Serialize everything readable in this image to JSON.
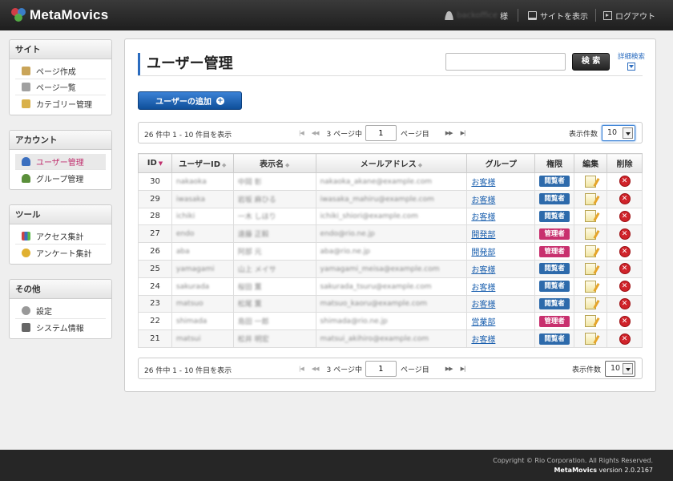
{
  "header": {
    "app_name": "MetaMovics",
    "user_name": "backoffice",
    "user_suffix": "様",
    "view_site": "サイトを表示",
    "logout": "ログアウト"
  },
  "sidebar": [
    {
      "title": "サイト",
      "items": [
        {
          "label": "ページ作成",
          "icon": "page-create-icon",
          "color": "#c9a458"
        },
        {
          "label": "ページ一覧",
          "icon": "page-list-icon",
          "color": "#a0a0a0"
        },
        {
          "label": "カテゴリー管理",
          "icon": "category-icon",
          "color": "#d9b14a"
        }
      ]
    },
    {
      "title": "アカウント",
      "items": [
        {
          "label": "ユーザー管理",
          "icon": "user-icon",
          "color": "#3b6fbf",
          "active": true
        },
        {
          "label": "グループ管理",
          "icon": "group-icon",
          "color": "#5a8f3a"
        }
      ]
    },
    {
      "title": "ツール",
      "items": [
        {
          "label": "アクセス集計",
          "icon": "chart-icon",
          "color": "#cc4444"
        },
        {
          "label": "アンケート集計",
          "icon": "survey-icon",
          "color": "#e0b030"
        }
      ]
    },
    {
      "title": "その他",
      "items": [
        {
          "label": "設定",
          "icon": "gear-icon",
          "color": "#999999"
        },
        {
          "label": "システム情報",
          "icon": "monitor-icon",
          "color": "#666666"
        }
      ]
    }
  ],
  "main": {
    "title": "ユーザー管理",
    "search_placeholder": "",
    "search_button": "検 索",
    "advanced_search": "詳細検索",
    "add_user": "ユーザーの追加",
    "pager": {
      "info": "26 件中 1 - 10 件目を表示",
      "total_pages_label": "3 ページ中",
      "page_value": "1",
      "page_suffix": "ページ目",
      "count_label": "表示件数",
      "count_value": "10"
    },
    "columns": [
      "ID",
      "ユーザーID",
      "表示名",
      "メールアドレス",
      "グループ",
      "権限",
      "編集",
      "削除"
    ],
    "rows": [
      {
        "id": "30",
        "uid": "nakaoka",
        "name": "中岡 彰",
        "email": "nakaoka_akane@example.com",
        "group": "お客様",
        "role": "閲覧者"
      },
      {
        "id": "29",
        "uid": "iwasaka",
        "name": "岩坂 麻ひる",
        "email": "iwasaka_mahiru@example.com",
        "group": "お客様",
        "role": "閲覧者"
      },
      {
        "id": "28",
        "uid": "ichiki",
        "name": "一木 しほり",
        "email": "ichiki_shiori@example.com",
        "group": "お客様",
        "role": "閲覧者"
      },
      {
        "id": "27",
        "uid": "endo",
        "name": "遠藤 正毅",
        "email": "endo@rio.ne.jp",
        "group": "開発部",
        "role": "管理者"
      },
      {
        "id": "26",
        "uid": "aba",
        "name": "阿部 元",
        "email": "aba@rio.ne.jp",
        "group": "開発部",
        "role": "管理者"
      },
      {
        "id": "25",
        "uid": "yamagami",
        "name": "山上 メイサ",
        "email": "yamagami_meisa@example.com",
        "group": "お客様",
        "role": "閲覧者"
      },
      {
        "id": "24",
        "uid": "sakurada",
        "name": "桜田 薫",
        "email": "sakurada_tsuru@example.com",
        "group": "お客様",
        "role": "閲覧者"
      },
      {
        "id": "23",
        "uid": "matsuo",
        "name": "松尾 薫",
        "email": "matsuo_kaoru@example.com",
        "group": "お客様",
        "role": "閲覧者"
      },
      {
        "id": "22",
        "uid": "shimada",
        "name": "島田 一郎",
        "email": "shimada@rio.ne.jp",
        "group": "営業部",
        "role": "管理者"
      },
      {
        "id": "21",
        "uid": "matsui",
        "name": "松井 明宏",
        "email": "matsui_akihiro@example.com",
        "group": "お客様",
        "role": "閲覧者"
      }
    ]
  },
  "roles": {
    "閲覧者": "#2d6aab",
    "管理者": "#c8306e"
  },
  "footer": {
    "copyright": "Copyright © Rio Corporation. All Rights Reserved.",
    "brand": "MetaMovics",
    "version": "version 2.0.2167"
  }
}
